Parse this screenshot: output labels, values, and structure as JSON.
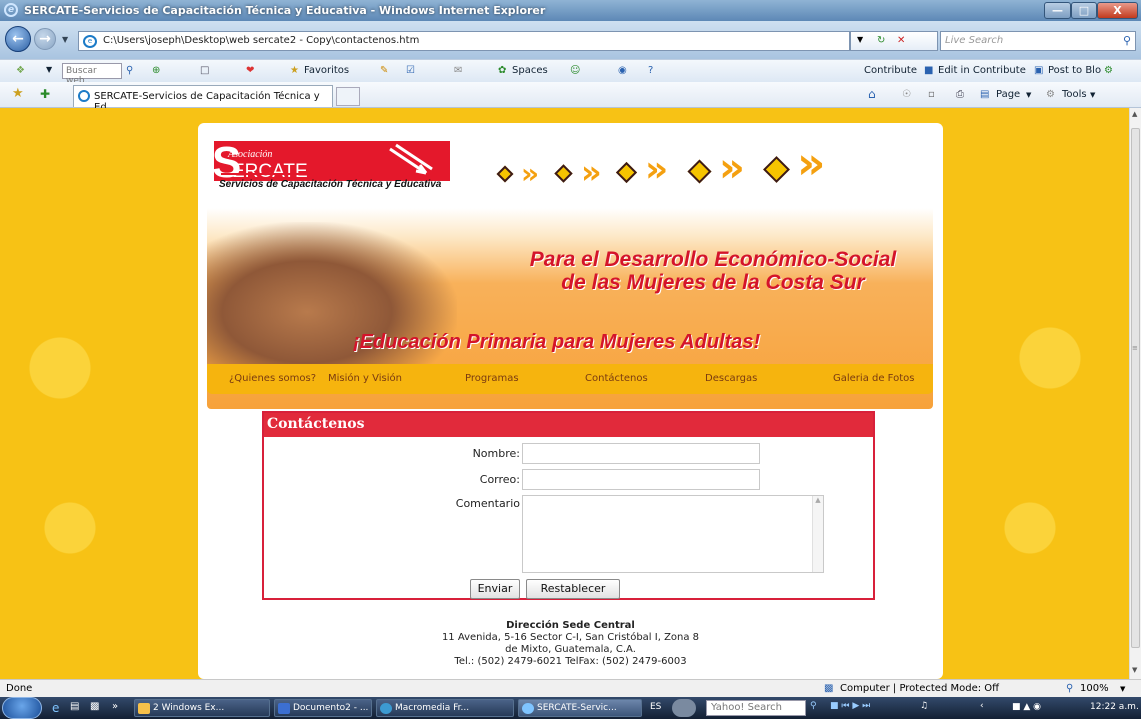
{
  "window": {
    "title": "SERCATE-Servicios de Capacitación Técnica y Educativa - Windows Internet Explorer",
    "minimize": "—",
    "maximize": "□",
    "close": "X"
  },
  "navbar": {
    "address": "C:\\Users\\joseph\\Desktop\\web sercate2 - Copy\\contactenos.htm",
    "search_placeholder": "Live Search"
  },
  "toolbar2": {
    "search_placeholder": "Buscar web..",
    "favoritos": "Favoritos",
    "spaces": "Spaces",
    "contribute": "Contribute",
    "edit_in_contribute": "Edit in Contribute",
    "post_to_blog": "Post to Blo"
  },
  "favbar": {
    "tab_title": "SERCATE-Servicios de Capacitación Técnica y Ed...",
    "page": "Page",
    "tools": "Tools"
  },
  "page": {
    "logo": {
      "tagline": "Asociación",
      "initial": "S",
      "name": "ERCATE",
      "subtitle": "Servicios de Capacitación Técnica y Educativa"
    },
    "slogan_line1": "Para el Desarrollo Económico-Social",
    "slogan_line2": "de las Mujeres de la Costa Sur",
    "slogan_banner": "¡Educación Primaria para Mujeres Adultas!",
    "menu": [
      "¿Quienes somos?",
      "Misión y Visión",
      "Programas",
      "Contáctenos",
      "Descargas",
      "Galeria de Fotos"
    ],
    "form": {
      "heading": "Contáctenos",
      "nombre_label": "Nombre:",
      "nombre_value": "",
      "correo_label": "Correo:",
      "correo_value": "",
      "comentario_label": "Comentario",
      "comentario_value": "",
      "submit": "Enviar",
      "reset": "Restablecer"
    },
    "footer": {
      "title": "Dirección Sede Central",
      "line1": "11 Avenida, 5-16 Sector C-I, San Cristóbal I, Zona 8",
      "line2": "de Mixto, Guatemala, C.A.",
      "line3": "Tel.: (502) 2479-6021 TelFax: (502) 2479-6003"
    }
  },
  "statusbar": {
    "left": "Done",
    "zone": "Computer | Protected Mode: Off",
    "zoom": "100%"
  },
  "taskbar": {
    "items": [
      "2 Windows Ex...",
      "Documento2 - ...",
      "Macromedia Fr...",
      "SERCATE-Servic..."
    ],
    "lang": "ES",
    "search_placeholder": "Yahoo! Search",
    "clock": "12:22 a.m."
  },
  "colors": {
    "page_background": "#f7c215",
    "brand_red": "#e4182b",
    "menu_bar": "#f6b40e"
  }
}
